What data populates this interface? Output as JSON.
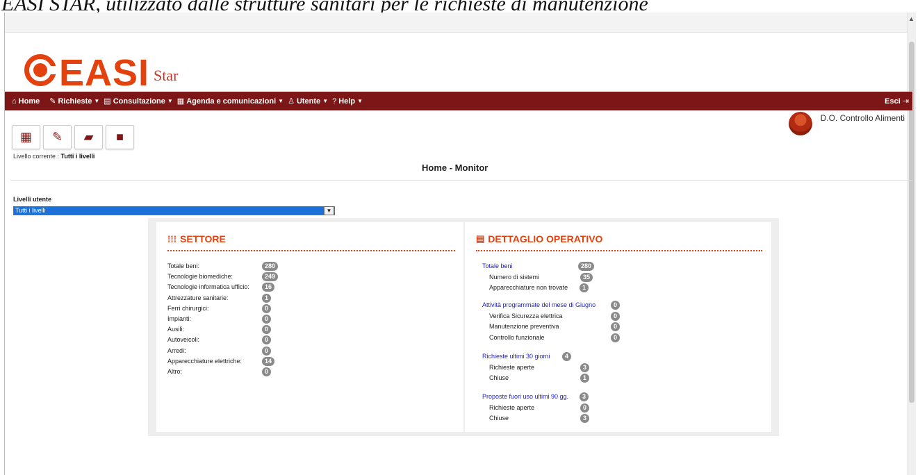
{
  "caption": "EASI STAR, utilizzato dalle strutture sanitari per le richieste di manutenzione",
  "logo": {
    "word": "EASI",
    "suffix": "Star"
  },
  "nav": {
    "home": "Home",
    "richieste": "Richieste",
    "consultazione": "Consultazione",
    "agenda": "Agenda e comunicazioni",
    "utente": "Utente",
    "help": "Help",
    "exit": "Esci"
  },
  "user": {
    "name": "D.O. Controllo Alimenti"
  },
  "level": {
    "label": "Livello corrente : ",
    "value": "Tutti i livelli"
  },
  "page_title": "Home - Monitor",
  "levels_select": {
    "label": "Livelli utente",
    "value": "Tutti i livelli"
  },
  "settore": {
    "title": "SETTORE",
    "rows": [
      {
        "label": "Totale beni:",
        "count": "280"
      },
      {
        "label": "Tecnologie biomediche:",
        "count": "249"
      },
      {
        "label": "Tecnologie informatica ufficio:",
        "count": "16"
      },
      {
        "label": "Attrezzature sanitarie:",
        "count": "1"
      },
      {
        "label": "Ferri chirurgici:",
        "count": "0"
      },
      {
        "label": "Impianti:",
        "count": "0"
      },
      {
        "label": "Ausili:",
        "count": "0"
      },
      {
        "label": "Autoveicoli:",
        "count": "0"
      },
      {
        "label": "Arredi:",
        "count": "0"
      },
      {
        "label": "Apparecchiature elettriche:",
        "count": "14"
      },
      {
        "label": "Altro:",
        "count": "0"
      }
    ]
  },
  "dettaglio": {
    "title": "DETTAGLIO OPERATIVO",
    "groups": [
      {
        "title": "Totale beni",
        "count": "280",
        "items": [
          {
            "label": "Numero di sistemi",
            "count": "35"
          },
          {
            "label": "Apparecchiature non trovate",
            "count": "1"
          }
        ]
      },
      {
        "title": "Attività programmate del mese di Giugno",
        "count": "0",
        "items": [
          {
            "label": "Verifica Sicurezza elettrica",
            "count": "0"
          },
          {
            "label": "Manutenzione preventiva",
            "count": "0"
          },
          {
            "label": "Controllo funzionale",
            "count": "0"
          }
        ]
      },
      {
        "title": "Richieste ultimi 30 giorni",
        "count": "4",
        "items": [
          {
            "label": "Richieste aperte",
            "count": "3"
          },
          {
            "label": "Chiuse",
            "count": "1"
          }
        ]
      },
      {
        "title": "Proposte fuori uso ultimi 90 gg.",
        "count": "3",
        "items": [
          {
            "label": "Richieste aperte",
            "count": "0"
          },
          {
            "label": "Chiuse",
            "count": "3"
          }
        ]
      }
    ]
  }
}
